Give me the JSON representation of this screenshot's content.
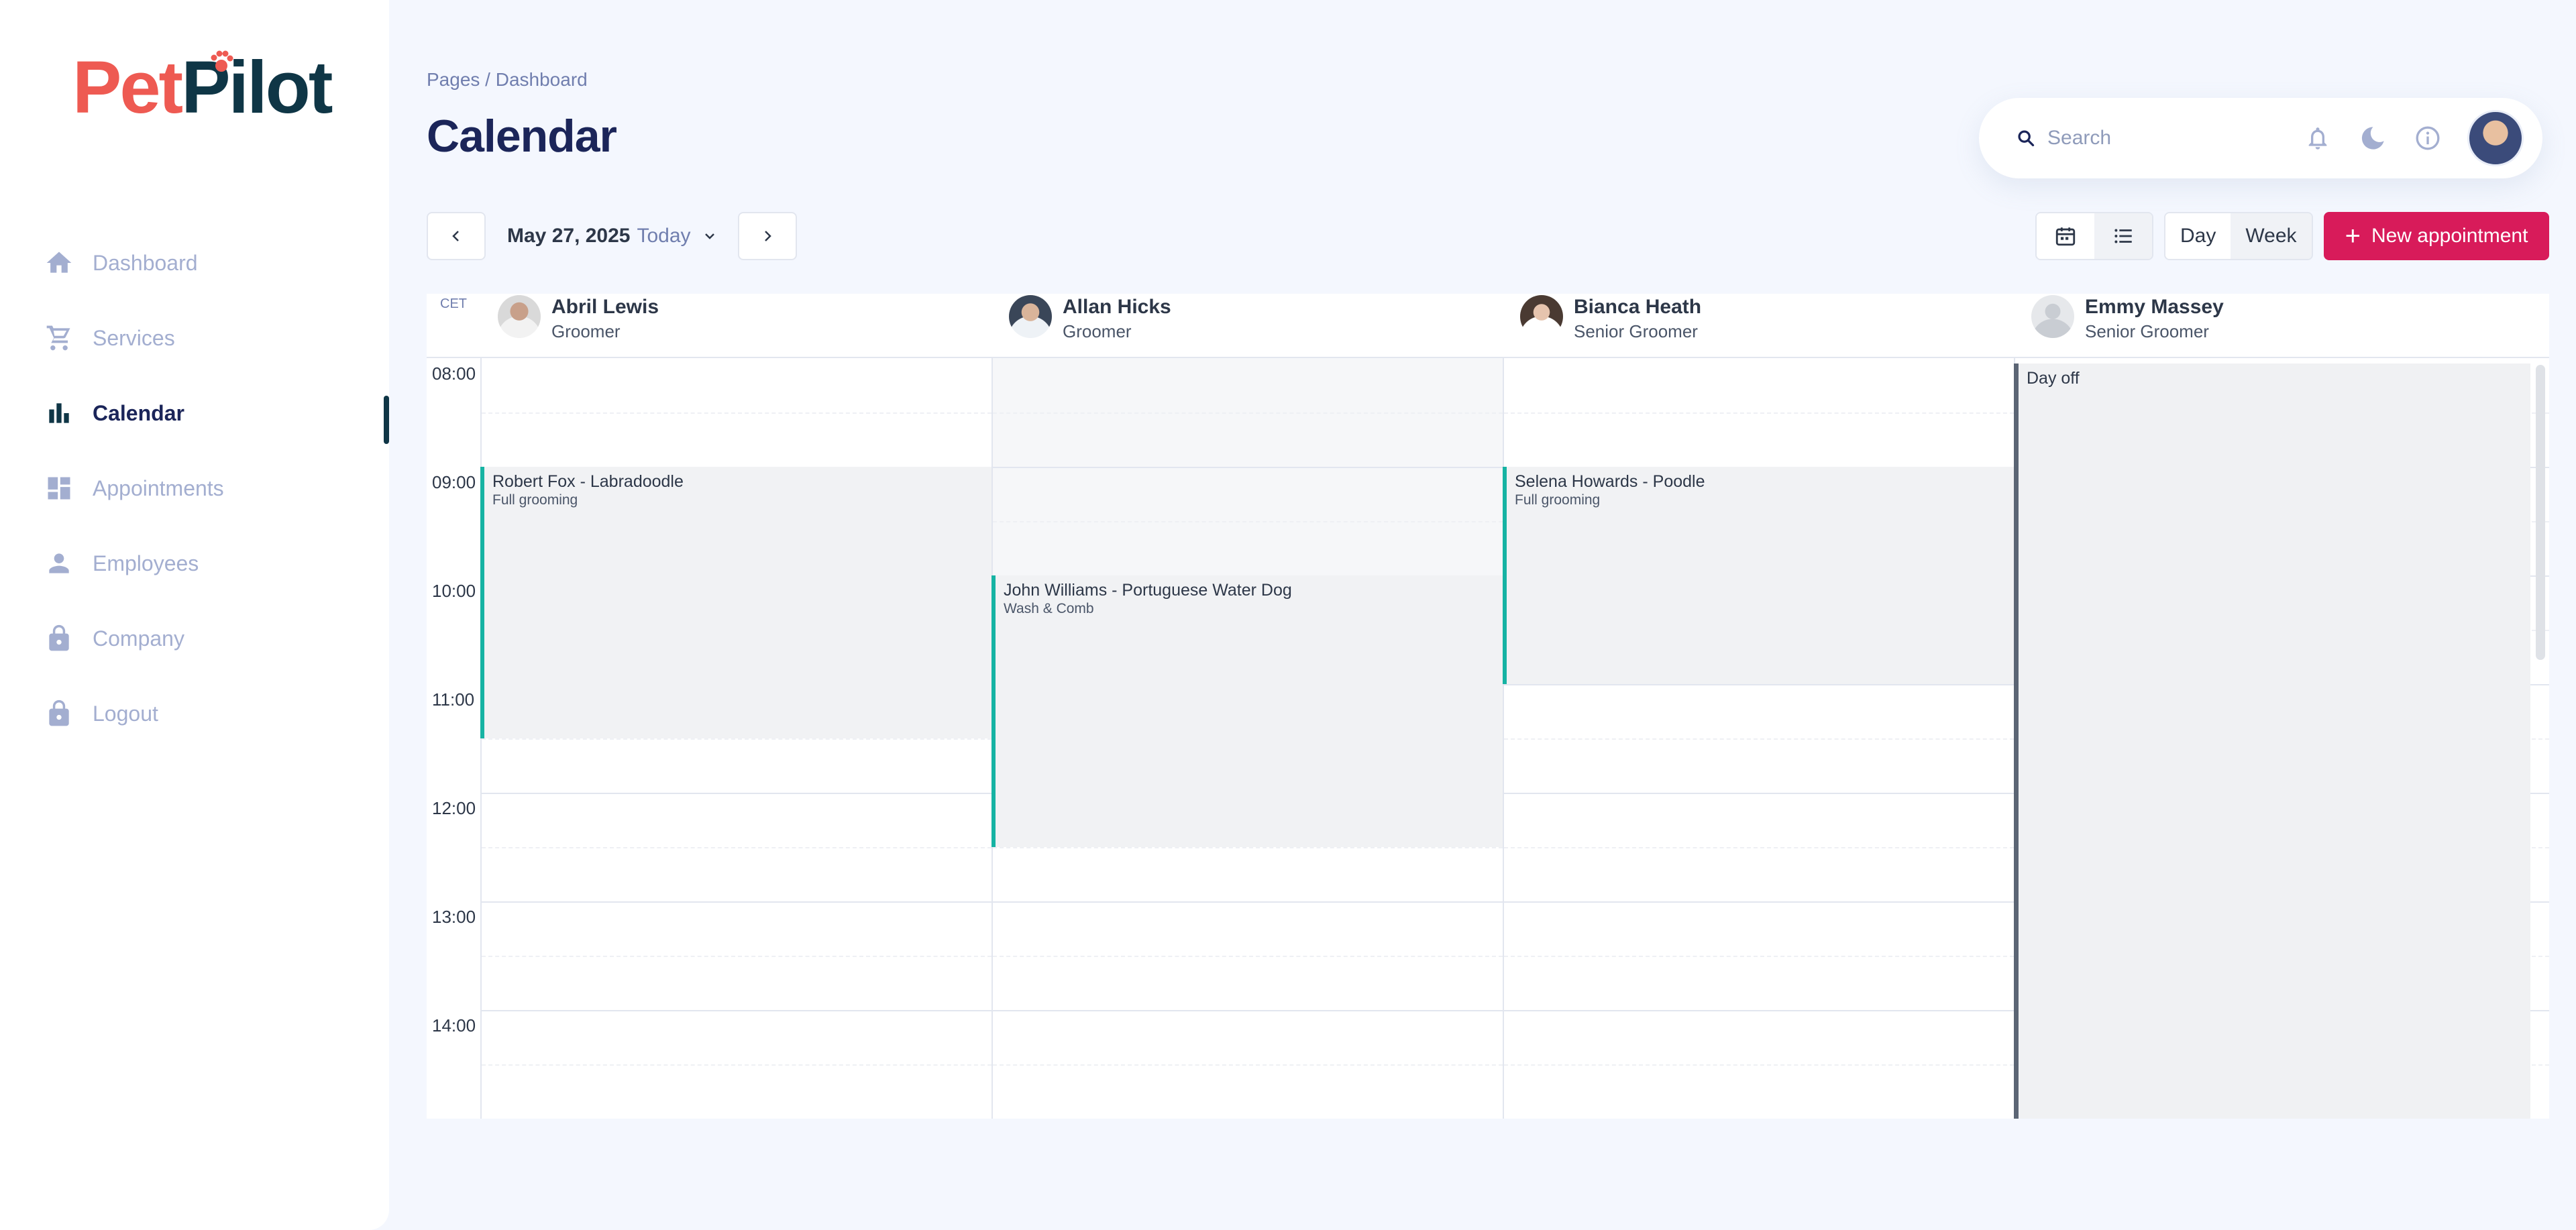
{
  "brand": {
    "logo_part1": "Pet",
    "logo_part2": "Pilot",
    "accent": "#d81b5a",
    "logo_red": "#ee5a52",
    "logo_dark": "#0f3646"
  },
  "sidebar": {
    "items": [
      {
        "label": "Dashboard",
        "icon": "home-icon",
        "active": false
      },
      {
        "label": "Services",
        "icon": "cart-icon",
        "active": false
      },
      {
        "label": "Calendar",
        "icon": "bar-chart-icon",
        "active": true
      },
      {
        "label": "Appointments",
        "icon": "dashboard-grid-icon",
        "active": false
      },
      {
        "label": "Employees",
        "icon": "person-icon",
        "active": false
      },
      {
        "label": "Company",
        "icon": "lock-icon",
        "active": false
      },
      {
        "label": "Logout",
        "icon": "lock-icon",
        "active": false
      }
    ]
  },
  "header": {
    "breadcrumb": "Pages / Dashboard",
    "title": "Calendar"
  },
  "topbar": {
    "search_placeholder": "Search"
  },
  "toolbar": {
    "date": "May 27, 2025",
    "today": "Today",
    "day_label": "Day",
    "week_label": "Week",
    "new_appointment": "New appointment"
  },
  "calendar": {
    "timezone": "CET",
    "hours": [
      "08:00",
      "09:00",
      "10:00",
      "11:00",
      "12:00",
      "13:00",
      "14:00"
    ],
    "employees": [
      {
        "name": "Abril Lewis",
        "role": "Groomer"
      },
      {
        "name": "Allan Hicks",
        "role": "Groomer"
      },
      {
        "name": "Bianca Heath",
        "role": "Senior Groomer"
      },
      {
        "name": "Emmy Massey",
        "role": "Senior Groomer"
      }
    ],
    "events": [
      {
        "employee": 0,
        "title": "Robert Fox - Labradoodle",
        "service": "Full grooming",
        "start": "09:00",
        "end": "11:30",
        "color": "#16b3a3"
      },
      {
        "employee": 1,
        "title": "John Williams -  Portuguese Water Dog",
        "service": "Wash & Comb",
        "start": "10:00",
        "end": "12:30",
        "color": "#16b3a3"
      },
      {
        "employee": 2,
        "title": "Selena Howards -  Poodle",
        "service": "Full grooming",
        "start": "09:00",
        "end": "11:00",
        "color": "#16b3a3"
      }
    ],
    "day_off": {
      "employee": 3,
      "label": "Day off"
    }
  }
}
